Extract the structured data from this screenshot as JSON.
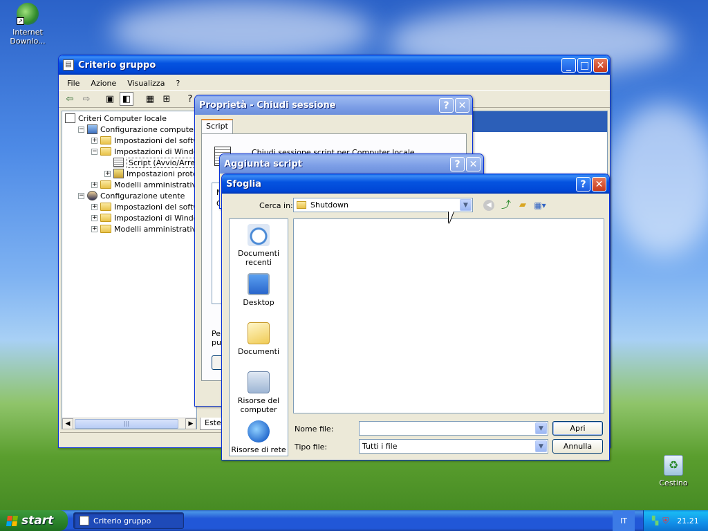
{
  "desktop": {
    "icons": [
      {
        "name": "internet-download-icon",
        "label": "Internet Downlo..."
      },
      {
        "name": "recycle-bin-icon",
        "label": "Cestino"
      }
    ]
  },
  "gpedit": {
    "title": "Criterio gruppo",
    "menu": [
      "File",
      "Azione",
      "Visualizza",
      "?"
    ],
    "tree": [
      {
        "label": "Criteri Computer locale",
        "level": 0,
        "exp": "",
        "icon": "policy"
      },
      {
        "label": "Configurazione computer",
        "level": 1,
        "exp": "−",
        "icon": "computer"
      },
      {
        "label": "Impostazioni del software",
        "level": 2,
        "exp": "+",
        "icon": "folder"
      },
      {
        "label": "Impostazioni di Windows",
        "level": 2,
        "exp": "−",
        "icon": "folder"
      },
      {
        "label": "Script (Avvio/Arresto)",
        "level": 3,
        "exp": "",
        "icon": "script"
      },
      {
        "label": "Impostazioni protezione",
        "level": 3,
        "exp": "+",
        "icon": "security"
      },
      {
        "label": "Modelli amministrativi",
        "level": 2,
        "exp": "+",
        "icon": "folder"
      },
      {
        "label": "Configurazione utente",
        "level": 1,
        "exp": "−",
        "icon": "user"
      },
      {
        "label": "Impostazioni del software",
        "level": 2,
        "exp": "+",
        "icon": "folder"
      },
      {
        "label": "Impostazioni di Windows",
        "level": 2,
        "exp": "+",
        "icon": "folder"
      },
      {
        "label": "Modelli amministrativi",
        "level": 2,
        "exp": "+",
        "icon": "folder"
      }
    ],
    "tab_partial": "Estes"
  },
  "props": {
    "title": "Proprietà - Chiudi sessione",
    "tab": "Script",
    "heading_partial": "Chiudi sessione script per Computer locale",
    "list_partial_1": "N",
    "list_partial_2": "C",
    "text_partial_1": "Per",
    "text_partial_2": "pul"
  },
  "addscript": {
    "title": "Aggiunta script"
  },
  "browse": {
    "title": "Sfoglia",
    "lookin_label": "Cerca in:",
    "lookin_value": "Shutdown",
    "places": [
      "Documenti recenti",
      "Desktop",
      "Documenti",
      "Risorse del computer",
      "Risorse di rete"
    ],
    "filename_label": "Nome file:",
    "filename_value": "",
    "filetype_label": "Tipo file:",
    "filetype_value": "Tutti i file",
    "open_button": "Apri",
    "cancel_button": "Annulla"
  },
  "taskbar": {
    "start": "start",
    "task": "Criterio gruppo",
    "lang": "IT",
    "clock": "21.21"
  }
}
